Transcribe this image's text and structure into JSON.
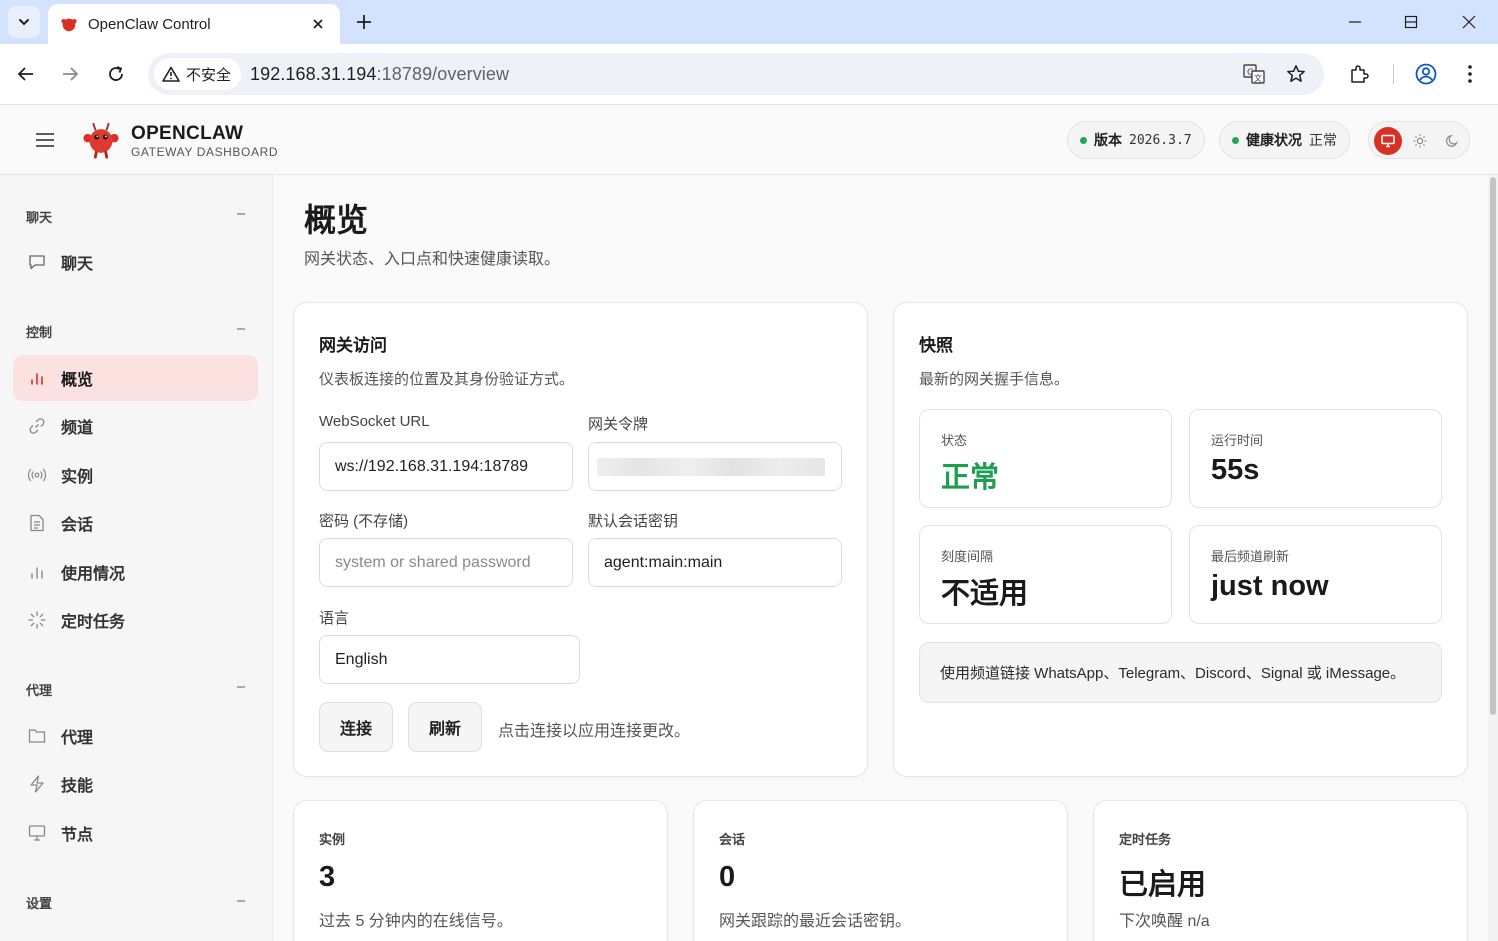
{
  "browser": {
    "tab_title": "OpenClaw Control",
    "security_label": "不安全",
    "url_host": "192.168.31.194",
    "url_rest": ":18789/overview"
  },
  "header": {
    "brand_title": "OPENCLAW",
    "brand_subtitle": "GATEWAY DASHBOARD",
    "version_label": "版本",
    "version_value": "2026.3.7",
    "health_label": "健康状况",
    "health_value": "正常"
  },
  "sidebar": {
    "sections": [
      {
        "title": "聊天",
        "items": [
          {
            "label": "聊天",
            "icon": "chat-icon"
          }
        ]
      },
      {
        "title": "控制",
        "items": [
          {
            "label": "概览",
            "icon": "bar-chart-icon",
            "active": true
          },
          {
            "label": "频道",
            "icon": "link-icon"
          },
          {
            "label": "实例",
            "icon": "radio-icon"
          },
          {
            "label": "会话",
            "icon": "document-icon"
          },
          {
            "label": "使用情况",
            "icon": "bar-chart-icon"
          },
          {
            "label": "定时任务",
            "icon": "loader-icon"
          }
        ]
      },
      {
        "title": "代理",
        "items": [
          {
            "label": "代理",
            "icon": "folder-icon"
          },
          {
            "label": "技能",
            "icon": "lightning-icon"
          },
          {
            "label": "节点",
            "icon": "monitor-icon"
          }
        ]
      },
      {
        "title": "设置",
        "items": []
      }
    ]
  },
  "page": {
    "title": "概览",
    "subtitle": "网关状态、入口点和快速健康读取。"
  },
  "gateway_access": {
    "title": "网关访问",
    "subtitle": "仪表板连接的位置及其身份验证方式。",
    "ws_label": "WebSocket URL",
    "ws_value": "ws://192.168.31.194:18789",
    "token_label": "网关令牌",
    "password_label": "密码 (不存储)",
    "password_placeholder": "system or shared password",
    "session_key_label": "默认会话密钥",
    "session_key_value": "agent:main:main",
    "language_label": "语言",
    "language_value": "English",
    "connect_button": "连接",
    "refresh_button": "刷新",
    "hint": "点击连接以应用连接更改。"
  },
  "snapshot": {
    "title": "快照",
    "subtitle": "最新的网关握手信息。",
    "status_label": "状态",
    "status_value": "正常",
    "uptime_label": "运行时间",
    "uptime_value": "55s",
    "tick_label": "刻度间隔",
    "tick_value": "不适用",
    "last_refresh_label": "最后频道刷新",
    "last_refresh_value": "just now",
    "note": "使用频道链接 WhatsApp、Telegram、Discord、Signal 或 iMessage。"
  },
  "summary": {
    "instances_label": "实例",
    "instances_value": "3",
    "instances_desc": "过去 5 分钟内的在线信号。",
    "sessions_label": "会话",
    "sessions_value": "0",
    "sessions_desc": "网关跟踪的最近会话密钥。",
    "cron_label": "定时任务",
    "cron_value": "已启用",
    "cron_desc": "下次唤醒 n/a"
  },
  "colors": {
    "accent": "#d93025",
    "active_nav_bg": "#fbe1df",
    "ok_green": "#1e9e4f",
    "chrome_tabstrip": "#d3e3fd"
  }
}
